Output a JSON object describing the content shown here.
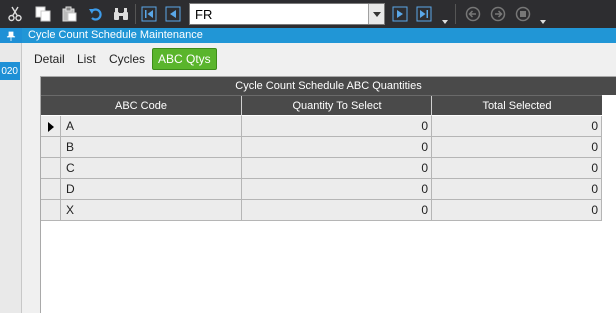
{
  "toolbar": {
    "combo_value": "FR",
    "icons": [
      "cut-icon",
      "copy-icon",
      "paste-icon",
      "undo-icon",
      "binoculars-icon",
      "first-icon",
      "prev-icon",
      "next-icon",
      "last-icon",
      "back-icon",
      "forward-icon",
      "home-icon"
    ]
  },
  "left": {
    "pin_label": "⇞",
    "tag_text": "020"
  },
  "window": {
    "title": "Cycle Count Schedule Maintenance"
  },
  "tabs": [
    {
      "label": "Detail"
    },
    {
      "label": "List"
    },
    {
      "label": "Cycles"
    },
    {
      "label": "ABC Qtys"
    }
  ],
  "grid": {
    "caption": "Cycle Count Schedule ABC Quantities",
    "columns": [
      "ABC Code",
      "Quantity To Select",
      "Total Selected"
    ],
    "rows": [
      {
        "code": "A",
        "qty": "0",
        "total": "0"
      },
      {
        "code": "B",
        "qty": "0",
        "total": "0"
      },
      {
        "code": "C",
        "qty": "0",
        "total": "0"
      },
      {
        "code": "D",
        "qty": "0",
        "total": "0"
      },
      {
        "code": "X",
        "qty": "0",
        "total": "0"
      }
    ]
  },
  "colors": {
    "accent": "#2196d6",
    "active_tab": "#5ab52c",
    "toolbar_bg": "#2d2d30",
    "grid_header": "#4a4a4a"
  }
}
